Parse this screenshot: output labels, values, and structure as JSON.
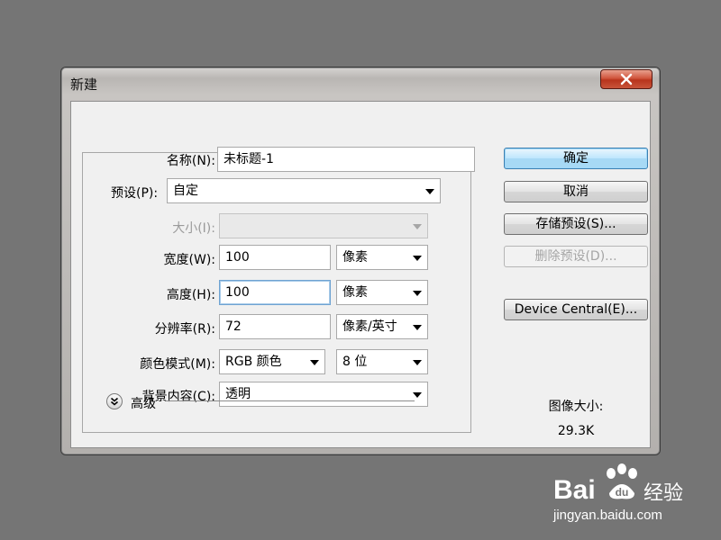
{
  "dialog": {
    "title": "新建",
    "fields": {
      "name": {
        "label": "名称(N):",
        "value": "未标题-1"
      },
      "preset": {
        "label": "预设(P):",
        "value": "自定"
      },
      "size": {
        "label": "大小(I):",
        "value": ""
      },
      "width": {
        "label": "宽度(W):",
        "value": "100",
        "unit": "像素"
      },
      "height": {
        "label": "高度(H):",
        "value": "100",
        "unit": "像素"
      },
      "resolution": {
        "label": "分辨率(R):",
        "value": "72",
        "unit": "像素/英寸"
      },
      "color_mode": {
        "label": "颜色模式(M):",
        "value": "RGB 颜色",
        "depth": "8 位"
      },
      "background": {
        "label": "背景内容(C):",
        "value": "透明"
      }
    },
    "advanced_label": "高级",
    "buttons": {
      "ok": "确定",
      "cancel": "取消",
      "save_preset": "存储预设(S)...",
      "delete_preset": "删除预设(D)...",
      "device_central": "Device Central(E)..."
    },
    "image_size": {
      "label": "图像大小:",
      "value": "29.3K"
    }
  },
  "watermark": {
    "brand": "Bai",
    "brand_tail": "经验",
    "url": "jingyan.baidu.com"
  },
  "colors": {
    "background": "#757575",
    "close_button": "#c8472e",
    "default_button": "#a7d9f5"
  }
}
